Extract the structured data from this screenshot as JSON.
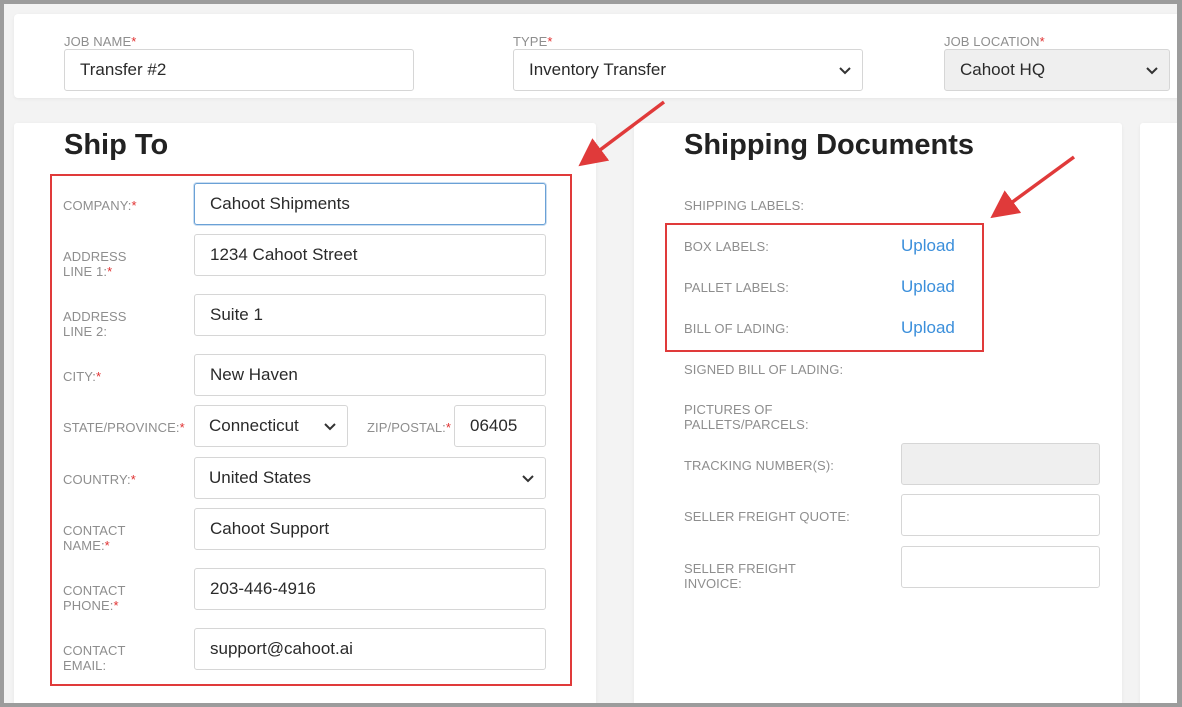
{
  "top": {
    "job_name": {
      "label": "JOB NAME",
      "value": "Transfer #2"
    },
    "type": {
      "label": "TYPE",
      "value": "Inventory Transfer"
    },
    "job_location": {
      "label": "JOB LOCATION",
      "value": "Cahoot HQ"
    }
  },
  "ship_to": {
    "title": "Ship To",
    "company": {
      "label": "COMPANY:",
      "value": "Cahoot Shipments"
    },
    "address1": {
      "label_line1": "ADDRESS",
      "label_line2": "LINE 1:",
      "value": "1234 Cahoot Street"
    },
    "address2": {
      "label_line1": "ADDRESS",
      "label_line2": "LINE 2:",
      "value": "Suite 1"
    },
    "city": {
      "label": "CITY:",
      "value": "New Haven"
    },
    "state": {
      "label": "STATE/PROVINCE:",
      "value": "Connecticut"
    },
    "zip": {
      "label": "ZIP/POSTAL:",
      "value": "06405"
    },
    "country": {
      "label": "COUNTRY:",
      "value": "United States"
    },
    "contact_name": {
      "label_line1": "CONTACT",
      "label_line2": "NAME:",
      "value": "Cahoot Support"
    },
    "contact_phone": {
      "label_line1": "CONTACT",
      "label_line2": "PHONE:",
      "value": "203-446-4916"
    },
    "contact_email": {
      "label_line1": "CONTACT",
      "label_line2": "EMAIL:",
      "value": "support@cahoot.ai"
    }
  },
  "shipping_docs": {
    "title": "Shipping Documents",
    "shipping_labels": "SHIPPING LABELS:",
    "box_labels": {
      "label": "BOX LABELS:",
      "action": "Upload"
    },
    "pallet_labels": {
      "label": "PALLET LABELS:",
      "action": "Upload"
    },
    "bill_of_lading": {
      "label": "BILL OF LADING:",
      "action": "Upload"
    },
    "signed_bol": "SIGNED BILL OF LADING:",
    "pictures": {
      "line1": "PICTURES OF",
      "line2": "PALLETS/PARCELS:"
    },
    "tracking": {
      "label": "TRACKING NUMBER(S):",
      "value": ""
    },
    "freight_quote": {
      "label": "SELLER FREIGHT QUOTE:",
      "value": ""
    },
    "freight_invoice": {
      "line1": "SELLER FREIGHT",
      "line2": "INVOICE:",
      "value": ""
    }
  },
  "colors": {
    "accent_link": "#3b8fdb",
    "required": "#e03030",
    "annotation": "#e03a3a"
  },
  "icons": {
    "select": "chevron-down-icon",
    "callout": "arrow-icon"
  }
}
